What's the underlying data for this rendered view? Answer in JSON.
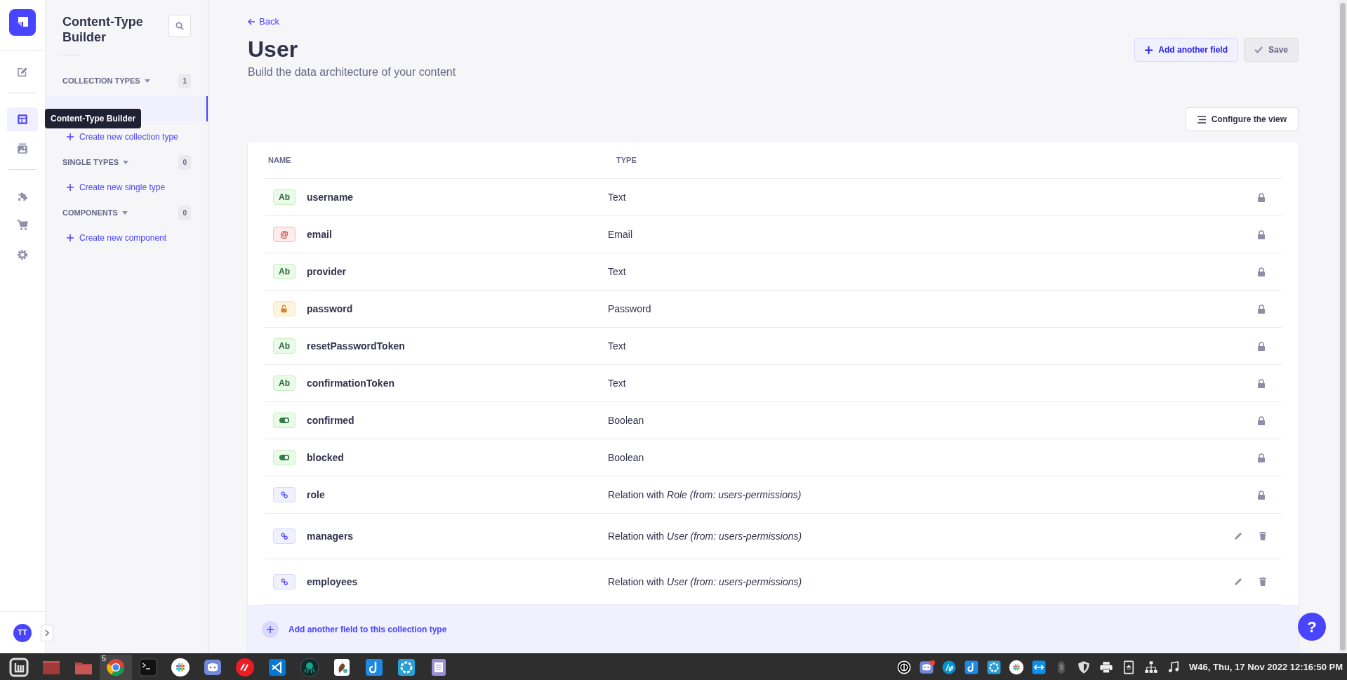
{
  "nav": {
    "items": [
      {
        "kind": "content",
        "selected": false
      },
      {
        "kind": "builder",
        "selected": true
      },
      {
        "kind": "media",
        "selected": false
      },
      {
        "kind": "plugins",
        "selected": false
      },
      {
        "kind": "marketplace",
        "selected": false
      },
      {
        "kind": "settings",
        "selected": false
      }
    ],
    "avatar": "TT"
  },
  "tooltip": "Content-Type Builder",
  "sidebar": {
    "title": "Content-Type Builder",
    "sections": [
      {
        "label": "COLLECTION TYPES",
        "count": "1",
        "items": [
          {
            "selected": true
          }
        ],
        "link": "Create new collection type"
      },
      {
        "label": "SINGLE TYPES",
        "count": "0",
        "link": "Create new single type"
      },
      {
        "label": "COMPONENTS",
        "count": "0",
        "link": "Create new component"
      }
    ]
  },
  "header": {
    "back": "Back",
    "title": "User",
    "subtitle": "Build the data architecture of your content",
    "buttons": [
      {
        "label": "Add another field",
        "kind": "add",
        "disabled": false
      },
      {
        "label": "Save",
        "kind": "save",
        "disabled": true
      }
    ],
    "configure": "Configure the view"
  },
  "table": {
    "columns": [
      "NAME",
      "TYPE"
    ],
    "rows": [
      {
        "kind": "text",
        "badge": "Ab",
        "name": "username",
        "type": "Text",
        "locked": true
      },
      {
        "kind": "email",
        "badge": "@",
        "name": "email",
        "type": "Email",
        "locked": true
      },
      {
        "kind": "text",
        "badge": "Ab",
        "name": "provider",
        "type": "Text",
        "locked": true
      },
      {
        "kind": "password",
        "name": "password",
        "type": "Password",
        "locked": true
      },
      {
        "kind": "text",
        "badge": "Ab",
        "name": "resetPasswordToken",
        "type": "Text",
        "locked": true
      },
      {
        "kind": "text",
        "badge": "Ab",
        "name": "confirmationToken",
        "type": "Text",
        "locked": true
      },
      {
        "kind": "boolean",
        "name": "confirmed",
        "type": "Boolean",
        "locked": true
      },
      {
        "kind": "boolean",
        "name": "blocked",
        "type": "Boolean",
        "locked": true
      },
      {
        "kind": "relation",
        "name": "role",
        "type": "Relation with *Role (from: users-permissions)*",
        "locked": true
      },
      {
        "kind": "relation",
        "name": "managers",
        "type": "Relation with *User (from: users-permissions)*",
        "locked": false
      },
      {
        "kind": "relation",
        "name": "employees",
        "type": "Relation with *User (from: users-permissions)*",
        "locked": false
      }
    ],
    "footer_link": "Add another field to this collection type"
  },
  "help": "?",
  "taskbar": {
    "launchers": [
      {
        "kind": "menu",
        "active": false
      },
      {
        "kind": "window",
        "active": false
      },
      {
        "kind": "folder",
        "active": false
      },
      {
        "kind": "browser",
        "active": true,
        "badge": "5"
      },
      {
        "kind": "terminal",
        "active": false
      },
      {
        "kind": "slack",
        "active": false
      },
      {
        "kind": "chat",
        "active": false
      },
      {
        "kind": "authy",
        "active": false
      },
      {
        "kind": "editor",
        "active": false
      },
      {
        "kind": "octo",
        "active": false
      },
      {
        "kind": "squirrel",
        "active": false
      },
      {
        "kind": "jletter",
        "active": false
      },
      {
        "kind": "aperture",
        "active": false
      },
      {
        "kind": "notes",
        "active": false
      }
    ],
    "tray": [
      {
        "kind": "power",
        "notification": false
      },
      {
        "kind": "chat",
        "notification": true
      },
      {
        "kind": "hp",
        "notification": false
      },
      {
        "kind": "jletter",
        "notification": false
      },
      {
        "kind": "aperture",
        "notification": false
      },
      {
        "kind": "slack",
        "notification": false
      },
      {
        "kind": "arrows",
        "notification": false
      },
      {
        "kind": "bluetooth",
        "notification": false
      },
      {
        "kind": "shield",
        "notification": false
      },
      {
        "kind": "printer",
        "notification": false
      },
      {
        "kind": "eject",
        "notification": false
      },
      {
        "kind": "network",
        "notification": false
      },
      {
        "kind": "music",
        "notification": false
      }
    ],
    "clock": "W46, Thu, 17 Nov 2022 12:16:50 PM"
  }
}
